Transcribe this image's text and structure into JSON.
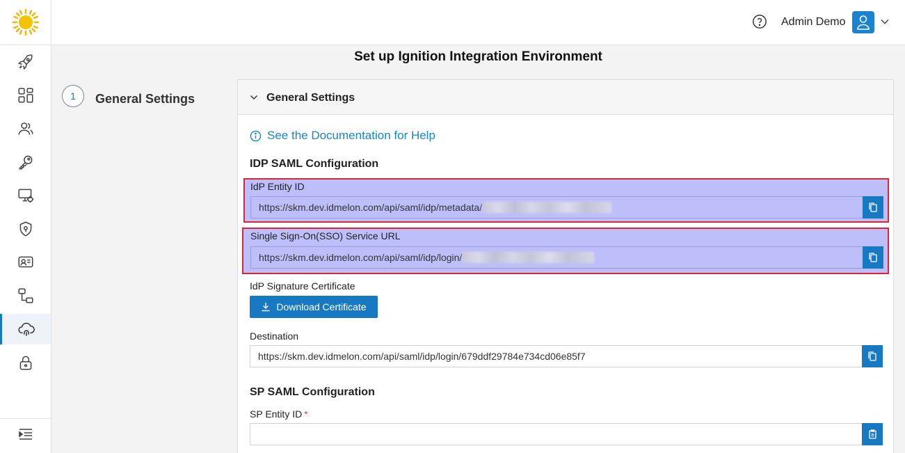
{
  "header": {
    "user_name": "Admin Demo"
  },
  "icons": {
    "logo": "sun-logo",
    "help": "help-circle-icon",
    "avatar": "user-icon",
    "user_menu": "chevron-down-icon"
  },
  "sidebar": {
    "items": [
      {
        "name": "rocket-icon"
      },
      {
        "name": "dashboard-icon"
      },
      {
        "name": "users-icon"
      },
      {
        "name": "key-icon"
      },
      {
        "name": "monitor-settings-icon"
      },
      {
        "name": "shield-icon"
      },
      {
        "name": "user-card-icon"
      },
      {
        "name": "workflow-icon"
      },
      {
        "name": "cloud-fingerprint-icon",
        "active": true
      },
      {
        "name": "lock-icon"
      }
    ],
    "collapse_icon": "menu-collapse-icon"
  },
  "page": {
    "title": "Set up Ignition Integration Environment"
  },
  "stepper": {
    "step_number": "1",
    "step_label": "General Settings"
  },
  "panel": {
    "title": "General Settings",
    "doc_link": "See the Documentation for Help",
    "idp_section": "IDP SAML Configuration",
    "idp_entity_label": "IdP Entity ID",
    "idp_entity_value": "https://skm.dev.idmelon.com/api/saml/idp/metadata/",
    "sso_label": "Single Sign-On(SSO) Service URL",
    "sso_value": "https://skm.dev.idmelon.com/api/saml/idp/login/",
    "cert_label": "IdP Signature Certificate",
    "download_label": "Download Certificate",
    "destination_label": "Destination",
    "destination_value": "https://skm.dev.idmelon.com/api/saml/idp/login/679ddf29784e734cd06e85f7",
    "sp_section": "SP SAML Configuration",
    "sp_entity_label": "SP Entity ID",
    "sp_entity_required": "*",
    "sp_entity_value": ""
  },
  "colors": {
    "accent": "#1779c2",
    "link": "#1a85c8",
    "highlight": "#6e6ef5",
    "highlight_border": "#d92632"
  }
}
